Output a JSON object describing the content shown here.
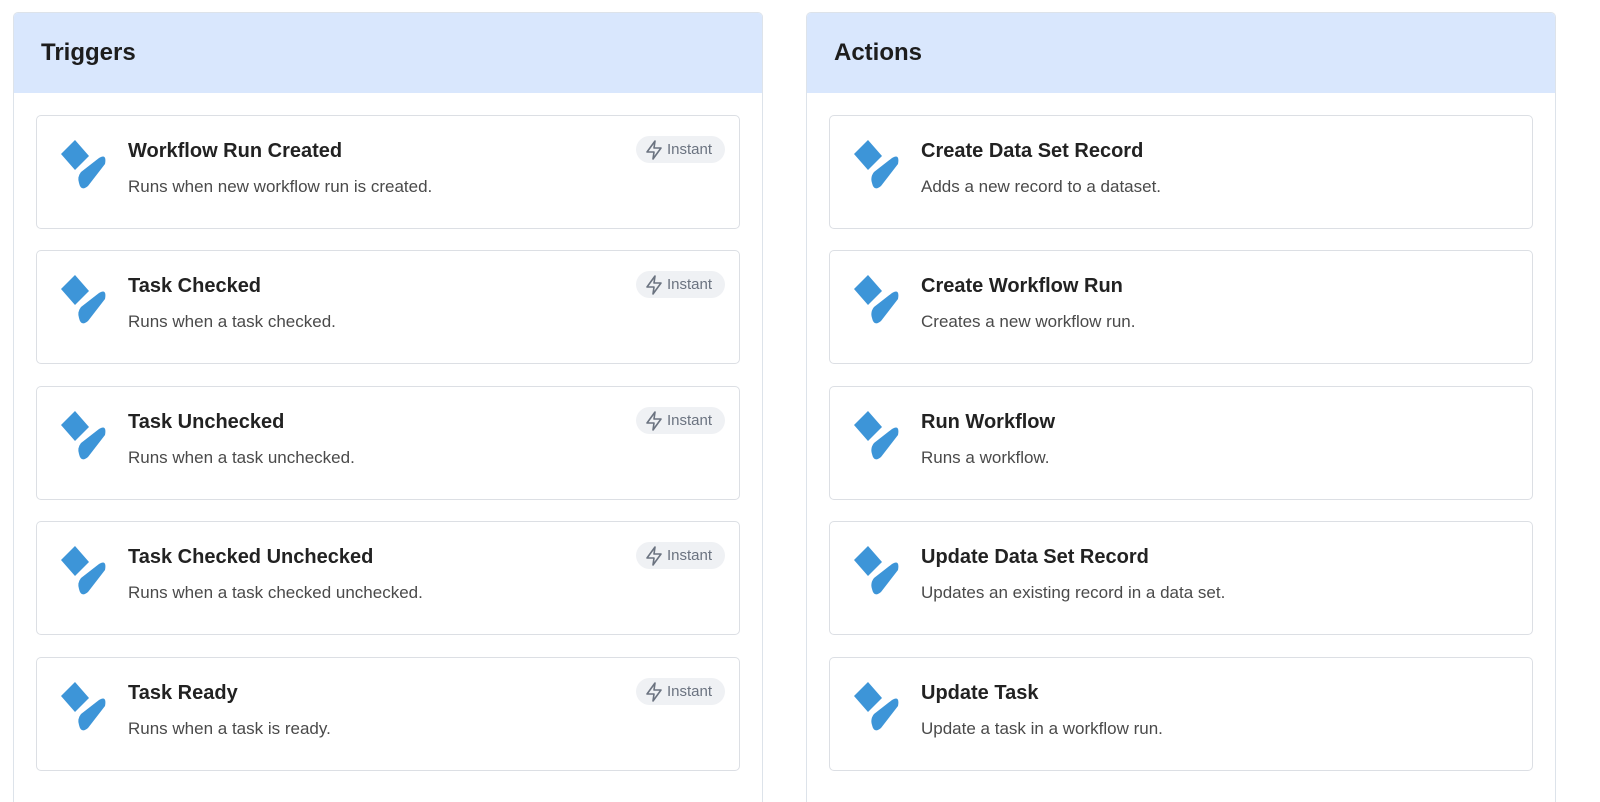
{
  "triggers": {
    "title": "Triggers",
    "items": [
      {
        "title": "Workflow Run Created",
        "description": "Runs when new workflow run is created.",
        "badge": "Instant"
      },
      {
        "title": "Task Checked",
        "description": "Runs when a task checked.",
        "badge": "Instant"
      },
      {
        "title": "Task Unchecked",
        "description": "Runs when a task unchecked.",
        "badge": "Instant"
      },
      {
        "title": "Task Checked Unchecked",
        "description": "Runs when a task checked unchecked.",
        "badge": "Instant"
      },
      {
        "title": "Task Ready",
        "description": "Runs when a task is ready.",
        "badge": "Instant"
      }
    ]
  },
  "actions": {
    "title": "Actions",
    "items": [
      {
        "title": "Create Data Set Record",
        "description": "Adds a new record to a dataset."
      },
      {
        "title": "Create Workflow Run",
        "description": "Creates a new workflow run."
      },
      {
        "title": "Run Workflow",
        "description": "Runs a workflow."
      },
      {
        "title": "Update Data Set Record",
        "description": "Updates an existing record in a data set."
      },
      {
        "title": "Update Task",
        "description": "Update a task in a workflow run."
      }
    ]
  },
  "icons": {
    "app_logo": "process-street-logo-icon",
    "badge": "lightning-bolt-icon"
  },
  "colors": {
    "header_background": "#d9e7fd",
    "logo_blue": "#3d95d8"
  }
}
